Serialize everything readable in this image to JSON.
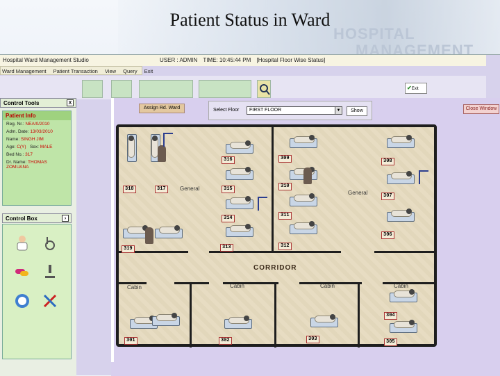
{
  "slide": {
    "title": "Patient Status in Ward",
    "hero_text_1": "HOSPITAL",
    "hero_text_2": "MANAGEMENT"
  },
  "window": {
    "app_title": "Hospital Ward Management Studio",
    "user": "USER : ADMIN",
    "time": "TIME: 10:45:44 PM",
    "view": "[Hospital Floor Wise Status]"
  },
  "menu": [
    "Ward Management",
    "Patient Transaction",
    "View",
    "Query",
    "Exit"
  ],
  "left": {
    "control_tools": "Control Tools",
    "close_x": "X",
    "patient_info_tab": "Patient Info",
    "patient_rows": [
      {
        "label": "Reg. Nr.:",
        "value": "NEA/0/2010"
      },
      {
        "label": "Adm. Date:",
        "value": "13/03/2010"
      },
      {
        "label": "Name:",
        "value": "SINGH JIM"
      },
      {
        "label": "Age:",
        "value": "C(Y)"
      },
      {
        "label": "Sex:",
        "value": "MALE"
      },
      {
        "label": "Bed No.:",
        "value": "317"
      },
      {
        "label": "Dr. Name:",
        "value": "THOMAS ZOMUANA"
      }
    ],
    "control_box": "Control Box",
    "arrow": "›"
  },
  "toolbar": {
    "assign_label": "Assign Rd. Ward",
    "select_floor_label": "Select Floor",
    "floor_value": "FIRST FLOOR",
    "show_label": "Show",
    "close_label": "Close Window",
    "exit_label": "Exit"
  },
  "plan": {
    "corridor": "CORRIDOR",
    "rooms": [
      "General",
      "General",
      "Cabin",
      "Cabin",
      "Cabin",
      "Cabin"
    ],
    "beds": [
      "316",
      "318",
      "317",
      "315",
      "314",
      "313",
      "319",
      "309",
      "310",
      "311",
      "312",
      "308",
      "307",
      "306",
      "301",
      "302",
      "303",
      "304",
      "305"
    ]
  }
}
